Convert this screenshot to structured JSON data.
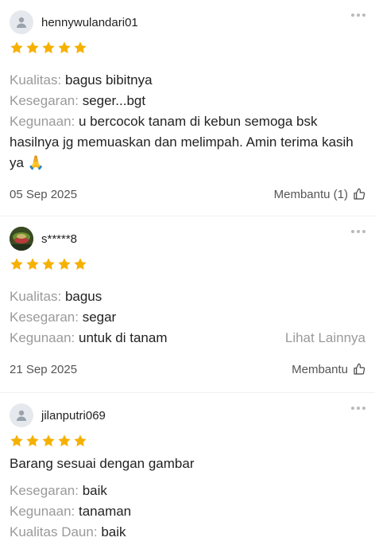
{
  "colors": {
    "star": "#f6b100",
    "label": "#9a9a9a",
    "text": "#222222"
  },
  "reviews": [
    {
      "username": "hennywulandari01",
      "rating": 5,
      "attributes": [
        {
          "label": "Kualitas:",
          "value": "bagus bibitnya"
        },
        {
          "label": "Kesegaran:",
          "value": "seger...bgt"
        },
        {
          "label": "Kegunaan:",
          "value": "u bercocok tanam di kebun semoga bsk hasilnya jg memuaskan dan melimpah. Amin terima kasih ya 🙏"
        }
      ],
      "date": "05 Sep 2025",
      "helpful_label": "Membantu (1)"
    },
    {
      "username": "s*****8",
      "rating": 5,
      "attributes": [
        {
          "label": "Kualitas:",
          "value": "bagus"
        },
        {
          "label": "Kesegaran:",
          "value": "segar"
        },
        {
          "label": "Kegunaan:",
          "value": "untuk di tanam"
        }
      ],
      "see_more": "Lihat Lainnya",
      "date": "21 Sep 2025",
      "helpful_label": "Membantu"
    },
    {
      "username": "jilanputri069",
      "rating": 5,
      "comment": "Barang sesuai dengan gambar",
      "attributes": [
        {
          "label": "Kesegaran:",
          "value": "baik"
        },
        {
          "label": "Kegunaan:",
          "value": "tanaman"
        },
        {
          "label": "Kualitas Daun:",
          "value": "baik"
        }
      ]
    }
  ],
  "icons": {
    "avatar_default": "person-icon",
    "avatar_custom": "profile-photo",
    "more": "more-options-icon",
    "star": "star-icon",
    "helpful": "thumbs-up-icon"
  }
}
